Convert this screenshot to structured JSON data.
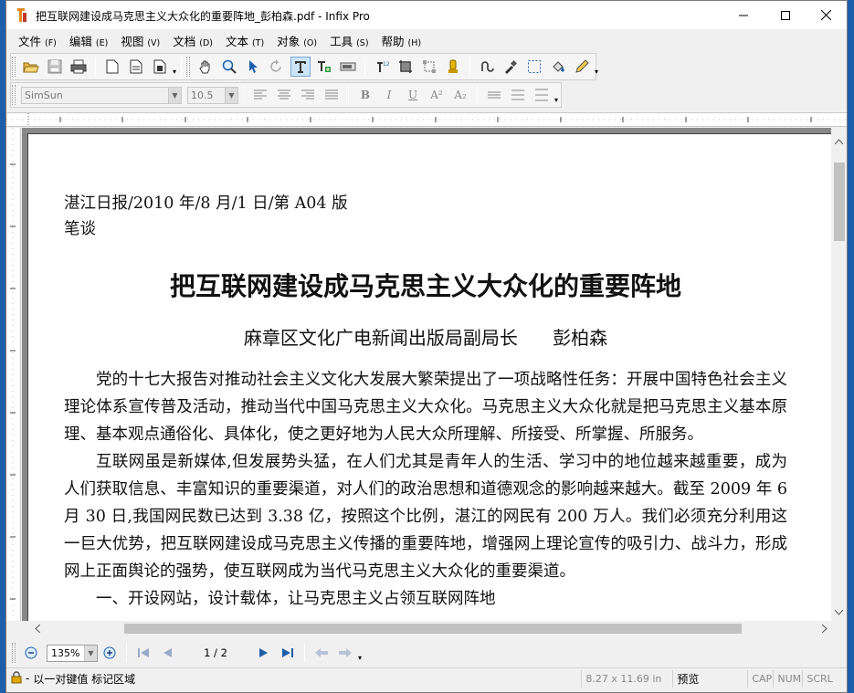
{
  "window": {
    "title": "把互联网建设成马克思主义大众化的重要阵地_彭柏森.pdf - Infix Pro",
    "minimize_glyph": "—",
    "maximize_glyph": "☐",
    "close_glyph": "✕"
  },
  "menu": {
    "items": [
      {
        "label": "文件",
        "accel": "(F)"
      },
      {
        "label": "编辑",
        "accel": "(E)"
      },
      {
        "label": "视图",
        "accel": "(V)"
      },
      {
        "label": "文档",
        "accel": "(D)"
      },
      {
        "label": "文本",
        "accel": "(T)"
      },
      {
        "label": "对象",
        "accel": "(O)"
      },
      {
        "label": "工具",
        "accel": "(S)"
      },
      {
        "label": "帮助",
        "accel": "(H)"
      }
    ]
  },
  "toolbar": {
    "icons": [
      "open-icon",
      "save-icon",
      "print-icon",
      "new-page-icon",
      "page-icon",
      "page-properties-icon",
      "hand-icon",
      "zoom-icon",
      "select-arrow-icon",
      "rotate-icon",
      "text-tool-icon",
      "add-text-icon",
      "field-icon",
      "spell-icon",
      "crop-icon",
      "transform-icon",
      "stamp-icon",
      "link-icon",
      "eyedropper-icon",
      "rect-select-icon",
      "fill-icon",
      "pencil-icon"
    ],
    "more_glyph": "▾"
  },
  "format_bar": {
    "font_value": "SimSun",
    "size_value": "10.5",
    "bold": "B",
    "italic": "I",
    "underline": "U",
    "superscript": "A²",
    "subscript": "A₂",
    "more_glyph": "▾"
  },
  "document": {
    "source_line": "湛江日报/2010 年/8 月/1 日/第 A04 版",
    "column_line": "笔谈",
    "title": "把互联网建设成马克思主义大众化的重要阵地",
    "author": "麻章区文化广电新闻出版局副局长      彭柏森",
    "paragraphs": [
      "党的十七大报告对推动社会主义文化大发展大繁荣提出了一项战略性任务：开展中国特色社会主义理论体系宣传普及活动，推动当代中国马克思主义大众化。马克思主义大众化就是把马克思主义基本原理、基本观点通俗化、具体化，使之更好地为人民大众所理解、所接受、所掌握、所服务。",
      "互联网虽是新媒体,但发展势头猛，在人们尤其是青年人的生活、学习中的地位越来越重要，成为人们获取信息、丰富知识的重要渠道，对人们的政治思想和道德观念的影响越来越大。截至 2009 年 6 月 30 日,我国网民数已达到 3.38 亿，按照这个比例，湛江的网民有 200 万人。我们必须充分利用这一巨大优势，把互联网建设成马克思主义传播的重要阵地，增强网上理论宣传的吸引力、战斗力，形成网上正面舆论的强势，使互联网成为当代马克思主义大众化的重要渠道。",
      "一、开设网站，设计载体，让马克思主义占领互联网阵地"
    ]
  },
  "navigation": {
    "zoom_value": "135%",
    "page_indicator": "1 / 2"
  },
  "status": {
    "message": "以一对键值 标记区域",
    "page_size": "8.27 x 11.69 in",
    "mode": "预览",
    "caps": "CAP",
    "num": "NUM",
    "scroll": "SCRL"
  }
}
